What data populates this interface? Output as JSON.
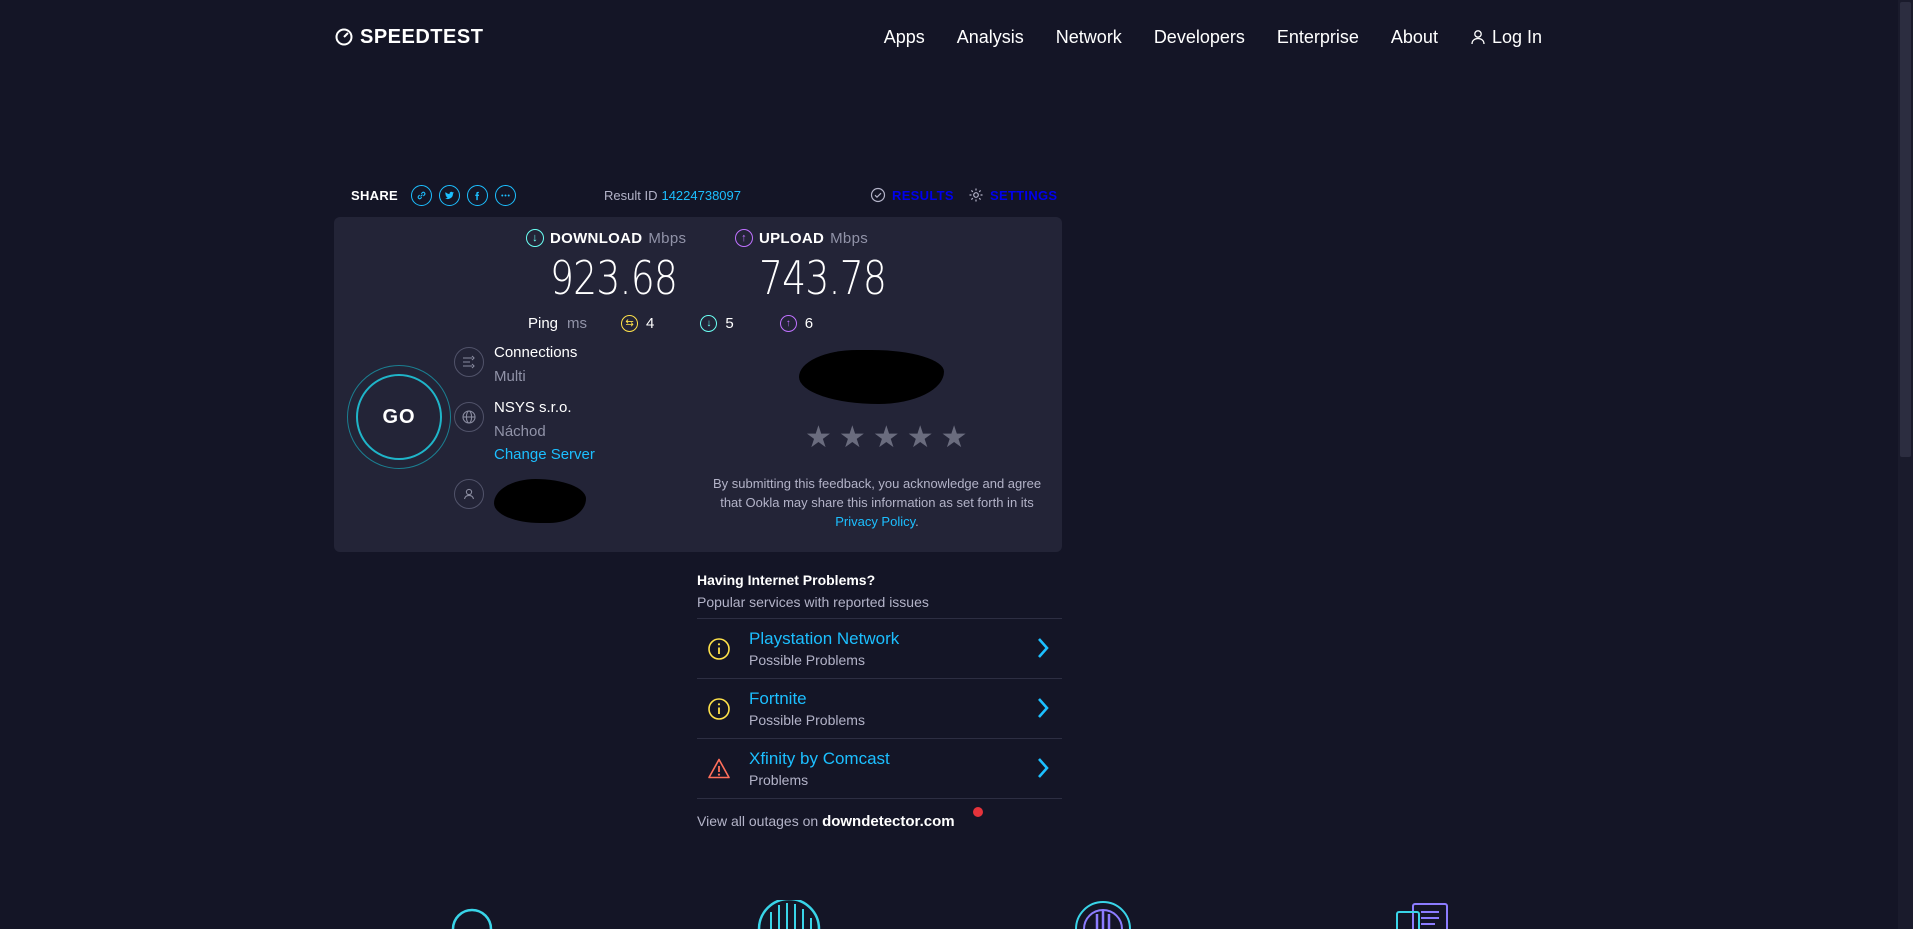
{
  "header": {
    "logo_text": "SPEEDTEST",
    "nav": [
      "Apps",
      "Analysis",
      "Network",
      "Developers",
      "Enterprise",
      "About"
    ],
    "login_label": "Log In"
  },
  "share": {
    "label": "SHARE",
    "icons": [
      "link-icon",
      "twitter-icon",
      "facebook-icon",
      "more-icon"
    ],
    "result_id_label": "Result ID",
    "result_id": "14224738097",
    "results_label": "RESULTS",
    "settings_label": "SETTINGS"
  },
  "download": {
    "label": "DOWNLOAD",
    "unit": "Mbps",
    "value": "923.68"
  },
  "upload": {
    "label": "UPLOAD",
    "unit": "Mbps",
    "value": "743.78"
  },
  "ping": {
    "label": "Ping",
    "unit": "ms",
    "idle": "4",
    "download": "5",
    "upload": "6"
  },
  "go_label": "GO",
  "connections": {
    "title": "Connections",
    "value": "Multi"
  },
  "server": {
    "name": "NSYS s.r.o.",
    "location": "Náchod",
    "change_label": "Change Server"
  },
  "rating": {
    "stars": 5
  },
  "feedback": {
    "text": "By submitting this feedback, you acknowledge and agree that Ookla may share this information as set forth in its",
    "link": "Privacy Policy",
    "end": "."
  },
  "problems": {
    "title": "Having Internet Problems?",
    "subtitle": "Popular services with reported issues",
    "items": [
      {
        "name": "Playstation Network",
        "status": "Possible Problems",
        "icon": "info-icon",
        "color": "#ffe24a"
      },
      {
        "name": "Fortnite",
        "status": "Possible Problems",
        "icon": "info-icon",
        "color": "#ffe24a"
      },
      {
        "name": "Xfinity by Comcast",
        "status": "Problems",
        "icon": "warning-icon",
        "color": "#ff6f5b"
      }
    ],
    "view_all_prefix": "View all outages on",
    "view_all_site": "downdetector.com"
  },
  "colors": {
    "background": "#141526",
    "panel": "#232437",
    "accent": "#1cbfff",
    "download": "#6afff3",
    "upload": "#bf71ff",
    "ping_idle": "#ffe24a"
  }
}
